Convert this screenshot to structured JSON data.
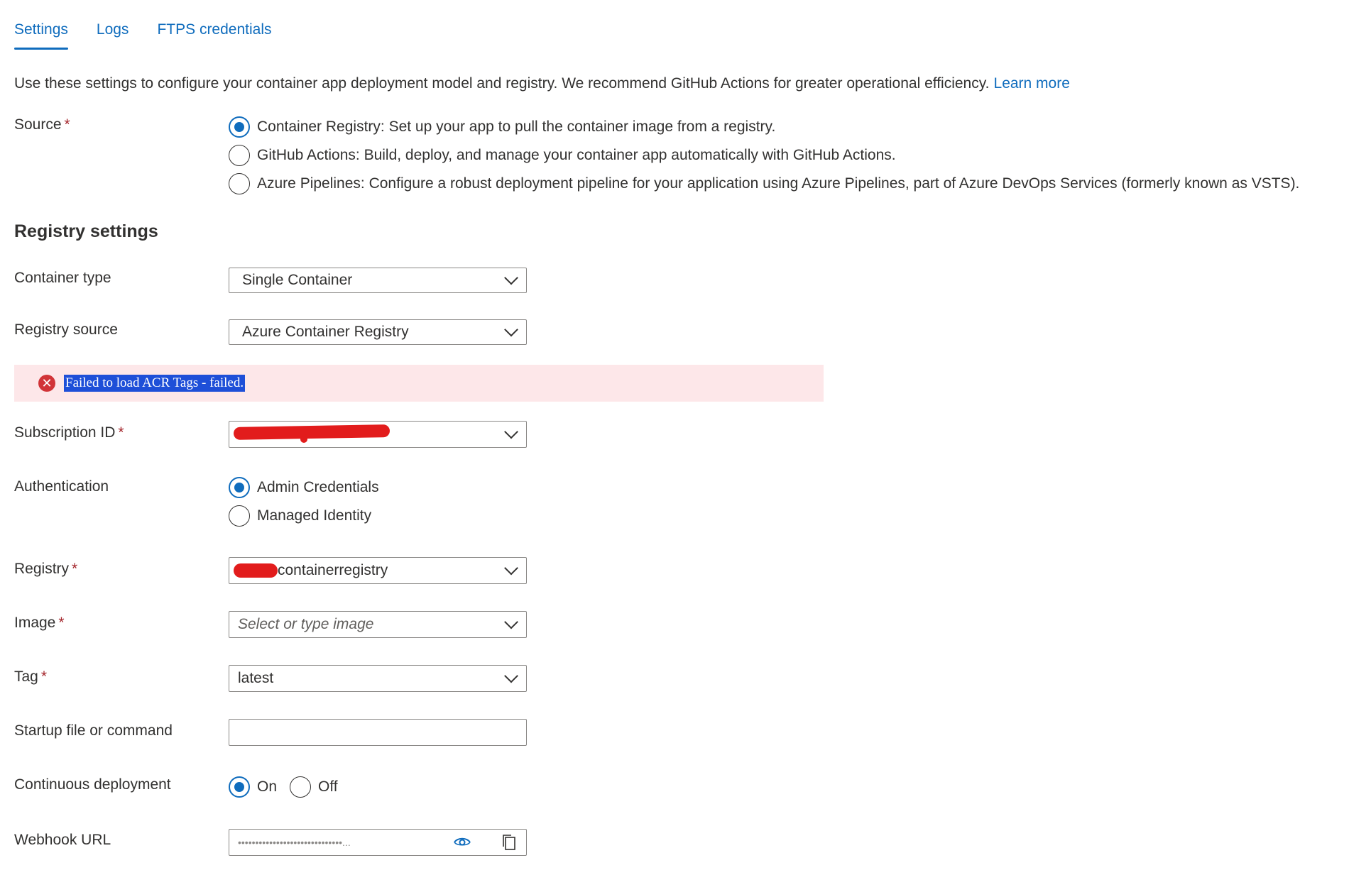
{
  "tabs": [
    {
      "label": "Settings",
      "active": true
    },
    {
      "label": "Logs",
      "active": false
    },
    {
      "label": "FTPS credentials",
      "active": false
    }
  ],
  "intro": {
    "text": "Use these settings to configure your container app deployment model and registry. We recommend GitHub Actions for greater operational efficiency.",
    "link": "Learn more"
  },
  "source": {
    "label": "Source",
    "options": [
      {
        "label": "Container Registry: Set up your app to pull the container image from a registry.",
        "checked": true
      },
      {
        "label": "GitHub Actions: Build, deploy, and manage your container app automatically with GitHub Actions.",
        "checked": false
      },
      {
        "label": "Azure Pipelines: Configure a robust deployment pipeline for your application using Azure Pipelines, part of Azure DevOps Services (formerly known as VSTS).",
        "checked": false
      }
    ]
  },
  "registry_settings": {
    "title": "Registry settings",
    "container_type": {
      "label": "Container type",
      "value": "Single Container"
    },
    "registry_source": {
      "label": "Registry source",
      "value": "Azure Container Registry"
    },
    "error": "Failed to load ACR Tags - failed.",
    "subscription_id": {
      "label": "Subscription ID",
      "value": ""
    },
    "authentication": {
      "label": "Authentication",
      "options": [
        {
          "label": "Admin Credentials",
          "checked": true
        },
        {
          "label": "Managed Identity",
          "checked": false
        }
      ]
    },
    "registry": {
      "label": "Registry",
      "value": "containerregistry"
    },
    "image": {
      "label": "Image",
      "placeholder": "Select or type image"
    },
    "tag": {
      "label": "Tag",
      "value": "latest"
    },
    "startup": {
      "label": "Startup file or command",
      "value": ""
    },
    "continuous_deployment": {
      "label": "Continuous deployment",
      "on": "On",
      "off": "Off",
      "selected": "On"
    },
    "webhook": {
      "label": "Webhook URL",
      "masked": "••••••••••••••••••••••••••••••..."
    }
  },
  "colors": {
    "accent": "#0f6cbd",
    "error_bg": "#fde7e9",
    "error_icon": "#d13438",
    "required": "#a4262c"
  }
}
